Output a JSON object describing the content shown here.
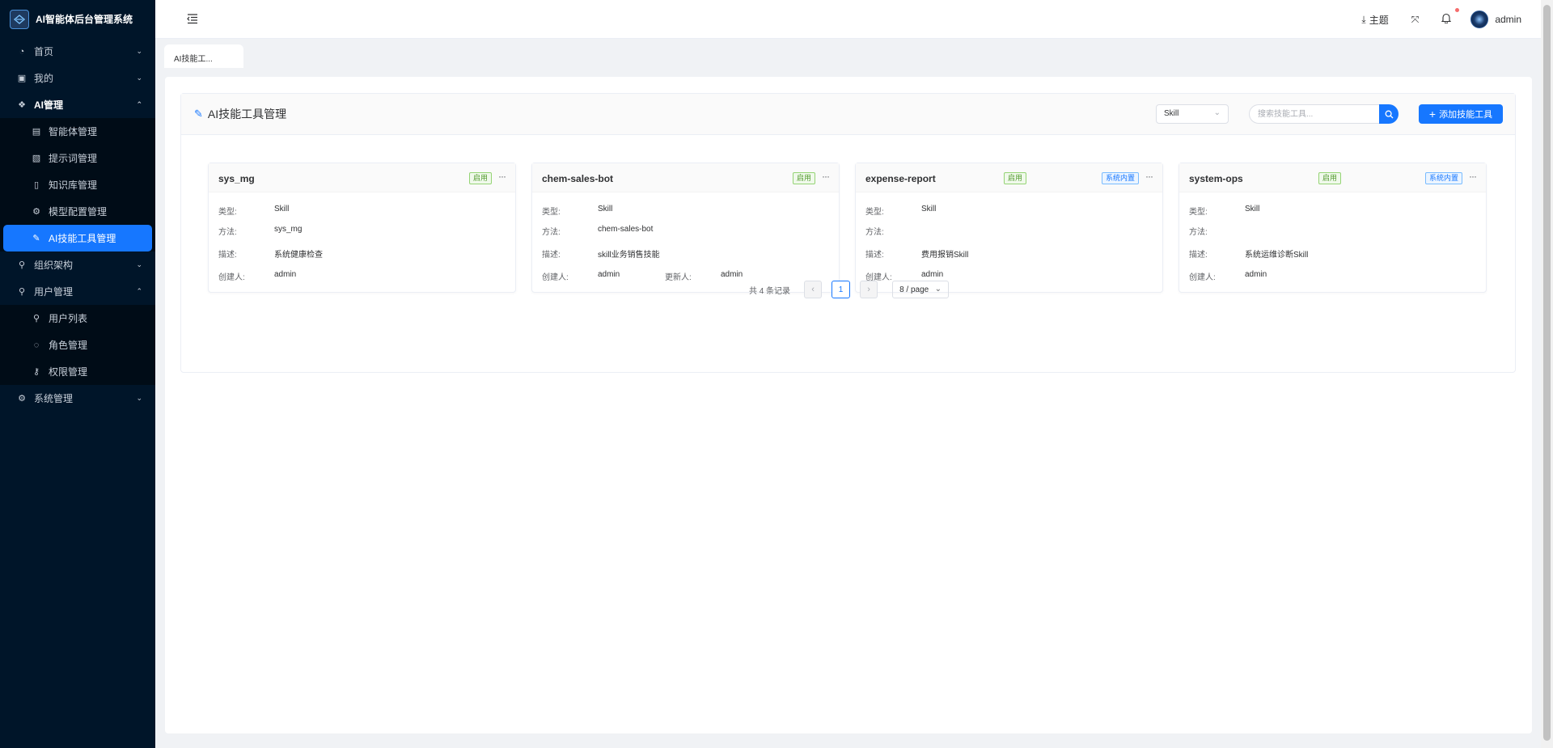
{
  "brand": {
    "title": "AI智能体后台管理系统"
  },
  "sidebar": {
    "items": [
      {
        "label": "首页",
        "icon": "dashboard-icon",
        "expanded": false
      },
      {
        "label": "我的",
        "icon": "profile-icon",
        "expanded": false
      },
      {
        "label": "AI管理",
        "icon": "ai-icon",
        "expanded": true,
        "children": [
          {
            "label": "智能体管理",
            "icon": "agent-icon"
          },
          {
            "label": "提示词管理",
            "icon": "prompt-icon"
          },
          {
            "label": "知识库管理",
            "icon": "knowledge-icon"
          },
          {
            "label": "模型配置管理",
            "icon": "model-gear-icon"
          },
          {
            "label": "AI技能工具管理",
            "icon": "tool-icon",
            "active": true
          }
        ]
      },
      {
        "label": "组织架构",
        "icon": "org-icon",
        "expanded": false
      },
      {
        "label": "用户管理",
        "icon": "user-icon",
        "expanded": true,
        "children": [
          {
            "label": "用户列表",
            "icon": "user-list-icon"
          },
          {
            "label": "角色管理",
            "icon": "role-icon"
          },
          {
            "label": "权限管理",
            "icon": "permission-icon"
          }
        ]
      },
      {
        "label": "系统管理",
        "icon": "settings-icon",
        "expanded": false
      }
    ]
  },
  "header": {
    "theme_label": "主题",
    "user_name": "admin"
  },
  "tabs": [
    {
      "label": "AI技能工..."
    }
  ],
  "panel": {
    "title": "AI技能工具管理",
    "type_filter": "Skill",
    "search_placeholder": "搜索技能工具...",
    "add_label": "添加技能工具"
  },
  "labels": {
    "type": "类型:",
    "method": "方法:",
    "desc": "描述:",
    "creator": "创建人:",
    "updater": "更新人:"
  },
  "cards": [
    {
      "name": "sys_mg",
      "status": "启用",
      "builtin": "",
      "type": "Skill",
      "method": "sys_mg",
      "desc": "系统健康检查",
      "creator": "admin",
      "updater": ""
    },
    {
      "name": "chem-sales-bot",
      "status": "启用",
      "builtin": "",
      "type": "Skill",
      "method": "chem-sales-bot",
      "desc": "skill业务销售技能",
      "creator": "admin",
      "updater": "admin"
    },
    {
      "name": "expense-report",
      "status": "启用",
      "builtin": "系统内置",
      "type": "Skill",
      "method": "",
      "desc": "费用报销Skill",
      "creator": "admin",
      "updater": ""
    },
    {
      "name": "system-ops",
      "status": "启用",
      "builtin": "系统内置",
      "type": "Skill",
      "method": "",
      "desc": "系统运维诊断Skill",
      "creator": "admin",
      "updater": ""
    }
  ],
  "pagination": {
    "total_text": "共 4 条记录",
    "current_page": "1",
    "page_size": "8 / page"
  },
  "colors": {
    "sidebar_bg": "#001529",
    "accent": "#1677ff",
    "tag_green": "#529b2e",
    "tag_blue": "#1677ff"
  }
}
